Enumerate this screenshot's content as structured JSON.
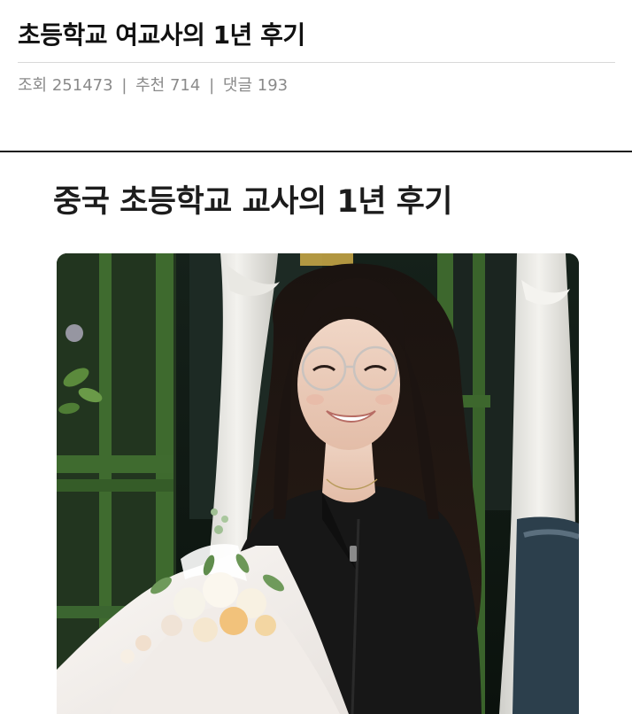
{
  "post": {
    "title": "초등학교 여교사의 1년 후기",
    "stats": [
      {
        "label": "조회",
        "value": "251473"
      },
      {
        "label": "추천",
        "value": "714"
      },
      {
        "label": "댓글",
        "value": "193"
      }
    ]
  },
  "content": {
    "embed_title": "중국 초등학교 교사의 1년 후기",
    "photo": {
      "subject": "smiling woman with glasses holding a bouquet of flowers"
    }
  }
}
